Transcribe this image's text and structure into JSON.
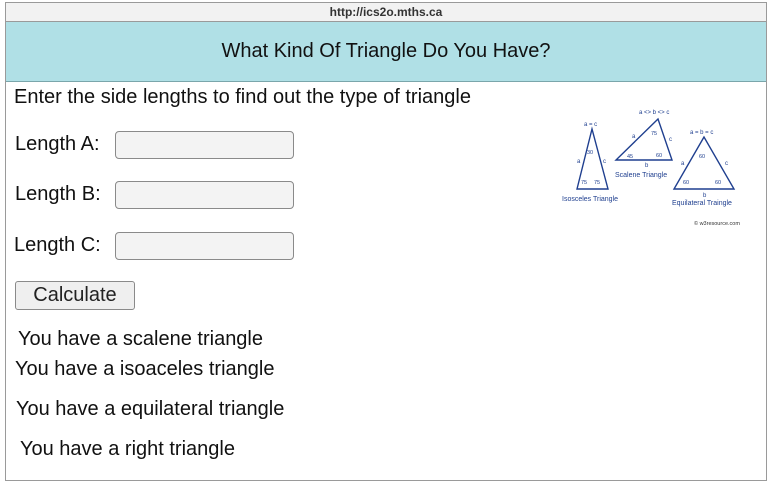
{
  "browser": {
    "url": "http://ics2o.mths.ca"
  },
  "header": {
    "title": "What Kind Of Triangle Do You Have?"
  },
  "intro": "Enter the side lengths to find out the type of triangle",
  "form": {
    "length_a_label": "Length A:",
    "length_b_label": "Length B:",
    "length_c_label": "Length C:",
    "length_a_value": "",
    "length_b_value": "",
    "length_c_value": "",
    "calculate_label": "Calculate"
  },
  "results": [
    "You have a scalene triangle",
    "You have a isoaceles triangle",
    "You have a equilateral triangle",
    "You have a right triangle"
  ],
  "diagram": {
    "isosceles": {
      "caption": "Isosceles Triangle",
      "formula": "a = c",
      "top_angle": "30",
      "left_angle": "75",
      "right_angle": "75",
      "side_a": "a",
      "side_c": "c"
    },
    "scalene": {
      "caption": "Scalene Triangle",
      "formula": "a <> b <> c",
      "top_angle": "75",
      "left_angle": "45",
      "right_angle": "60",
      "side_a": "a",
      "side_b": "b",
      "side_c": "c"
    },
    "equilateral": {
      "caption": "Equilateral Traingle",
      "formula": "a = b = c",
      "top_angle": "60",
      "left_angle": "60",
      "right_angle": "60",
      "side_a": "a",
      "side_b": "b",
      "side_c": "c"
    },
    "credit": "© w3resource.com",
    "colors": {
      "stroke": "#1f3f8f",
      "text": "#1f3f8f"
    }
  }
}
